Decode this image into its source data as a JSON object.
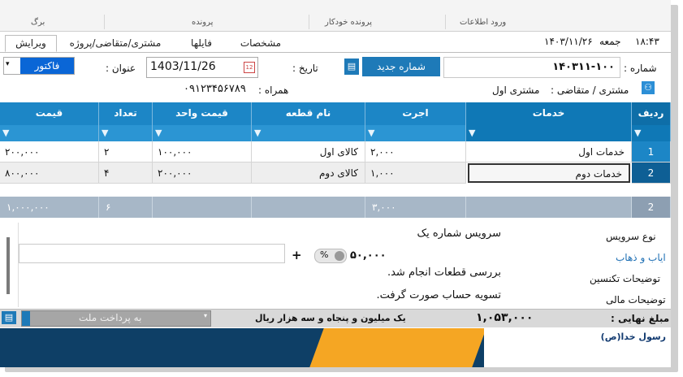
{
  "ribbon": {
    "items": [
      "ورود اطلاعات",
      "پرونده خودکار",
      "پرونده",
      "برگ"
    ]
  },
  "tabs": [
    "ویرایش",
    "مشتری/متقاضی/پروژه",
    "فایلها",
    "مشخصات"
  ],
  "header": {
    "time": "۱۸:۴۳",
    "day": "جمعه",
    "date": "۱۴۰۳/۱۱/۲۶"
  },
  "form": {
    "number_label": "شماره :",
    "number_value": "۱۴۰۳۱۱-۱۰۰",
    "new_number_button": "شماره جدید",
    "date_label": "تاریخ :",
    "date_value": "1403/11/26",
    "title_label": "عنوان :",
    "title_value": "فاکتور فروش",
    "customer_label": "مشتری / متقاضی :",
    "customer_value": "مشتری اول",
    "mobile_label": "همراه :",
    "mobile_value": "۰۹۱۲۳۴۵۶۷۸۹"
  },
  "grid": {
    "columns": [
      "ردیف",
      "خدمات",
      "اجرت",
      "نام قطعه",
      "قیمت واحد",
      "تعداد",
      "قیمت"
    ],
    "rows": [
      {
        "index": "1",
        "service": "خدمات اول",
        "fee": "۲,۰۰۰",
        "part": "کالای اول",
        "unit_price": "۱۰۰,۰۰۰",
        "qty": "۲",
        "price": "۲۰۰,۰۰۰"
      },
      {
        "index": "2",
        "service": "خدمات دوم",
        "fee": "۱,۰۰۰",
        "part": "کالای دوم",
        "unit_price": "۲۰۰,۰۰۰",
        "qty": "۴",
        "price": "۸۰۰,۰۰۰"
      }
    ],
    "totals": {
      "count": "2",
      "fee": "۳,۰۰۰",
      "qty": "۶",
      "price": "۱,۰۰۰,۰۰۰"
    }
  },
  "details": {
    "service_type_label": "نوع سرویس",
    "service_type_value": "سرویس شماره یک",
    "transport_label": "ایاب و ذهاب",
    "transport_value": "۵۰,۰۰۰",
    "percent_symbol": "%",
    "plus_symbol": "+",
    "tech_label": "توضیحات تکنسین",
    "tech_value": "بررسی قطعات انجام شد.",
    "finance_label": "توضیحات مالی",
    "finance_value": "تسویه حساب صورت گرفت."
  },
  "footer": {
    "final_label": "مبلغ نهایی :",
    "final_value": "۱,۰۵۳,۰۰۰",
    "final_words": "یک میلیون و پنجاه و سه هزار  ریال",
    "payment_dropdown": "به پرداخت ملت"
  },
  "banner": {
    "text": "رسول خدا(ص)"
  }
}
